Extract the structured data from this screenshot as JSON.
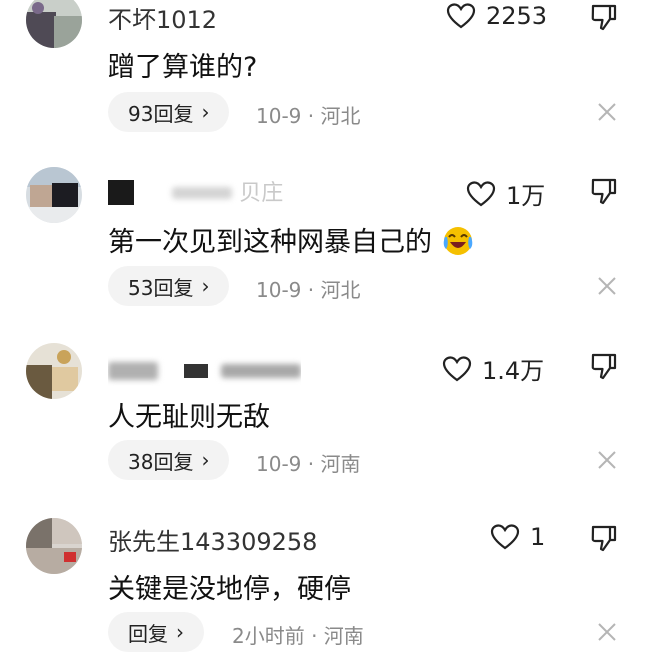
{
  "comments": [
    {
      "username": "不坏1012",
      "likes": "2253",
      "text": "蹭了算谁的?",
      "reply_label": "93回复",
      "meta": "10-9 · 河北"
    },
    {
      "username": "贝庄",
      "likes": "1万",
      "text": "第一次见到这种网暴自己的",
      "reply_label": "53回复",
      "meta": "10-9 · 河北"
    },
    {
      "username": "",
      "likes": "1.4万",
      "text": "人无耻则无敌",
      "reply_label": "38回复",
      "meta": "10-9 · 河南"
    },
    {
      "username": "张先生143309258",
      "likes": "1",
      "text": "关键是没地停，硬停",
      "reply_label": "回复",
      "meta": "2小时前 · 河南"
    }
  ],
  "icons": {
    "like": "heart-outline-icon",
    "dislike": "thumbs-down-icon",
    "close": "close-icon",
    "emoji": "laughing-tears-emoji"
  },
  "colors": {
    "text": "#111111",
    "meta": "#8a8a8a",
    "pill_bg": "#f3f3f3",
    "emoji": "#f5c000"
  }
}
